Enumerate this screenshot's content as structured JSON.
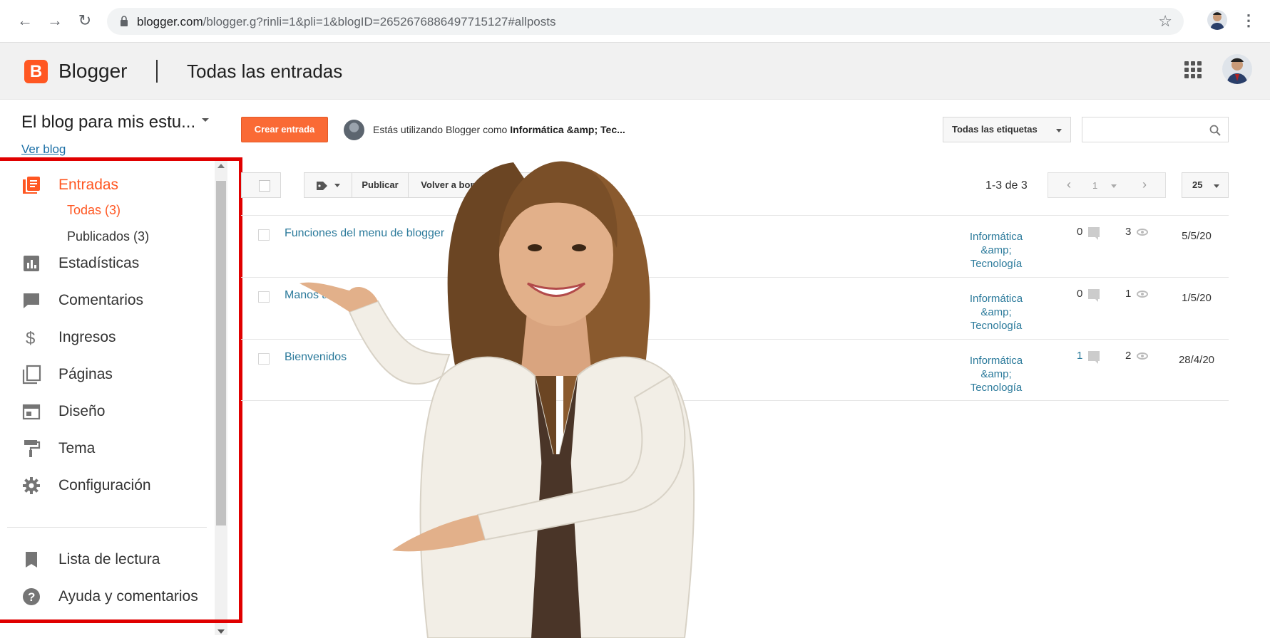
{
  "browser": {
    "url_host": "blogger.com",
    "url_path": "/blogger.g?rinli=1&pli=1&blogID=2652676886497715127#allposts"
  },
  "header": {
    "brand": "Blogger",
    "title": "Todas las entradas"
  },
  "sidebar": {
    "blog_name": "El blog para mis estu...",
    "view_blog": "Ver blog",
    "items": [
      {
        "label": "Entradas",
        "icon": "posts-icon"
      },
      {
        "label": "Estadísticas",
        "icon": "stats-icon"
      },
      {
        "label": "Comentarios",
        "icon": "comment-icon"
      },
      {
        "label": "Ingresos",
        "icon": "dollar-icon"
      },
      {
        "label": "Páginas",
        "icon": "pages-icon"
      },
      {
        "label": "Diseño",
        "icon": "layout-icon"
      },
      {
        "label": "Tema",
        "icon": "paint-roller-icon"
      },
      {
        "label": "Configuración",
        "icon": "gear-icon"
      },
      {
        "label": "Lista de lectura",
        "icon": "bookmark-icon"
      },
      {
        "label": "Ayuda y comentarios",
        "icon": "help-icon"
      }
    ],
    "sub_items": [
      {
        "label": "Todas (3)"
      },
      {
        "label": "Publicados (3)"
      }
    ]
  },
  "toolbar": {
    "create_label": "Crear entrada",
    "user_prefix": "Estás utilizando Blogger como ",
    "user_name": "Informática &amp; Tec...",
    "labels_filter": "Todas las etiquetas",
    "publish_label": "Publicar",
    "revert_label": "Volver a borrador",
    "pager_count": "1-3 de 3",
    "page": "1",
    "per_page": "25"
  },
  "posts": [
    {
      "title": "Funciones del menu de blogger",
      "label": "Informática &amp; Tecnología",
      "comments": "0",
      "views": "3",
      "date": "5/5/20"
    },
    {
      "title": "Manos a la obra",
      "label": "Informática &amp; Tecnología",
      "comments": "0",
      "views": "1",
      "date": "1/5/20"
    },
    {
      "title": "Bienvenidos",
      "label": "Informática &amp; Tecnología",
      "comments": "1",
      "views": "2",
      "date": "28/4/20"
    }
  ],
  "colors": {
    "brand_orange": "#ff5722",
    "create_button": "#fa6a35",
    "link_teal": "#2b7a9b",
    "highlight_frame": "#e00000"
  }
}
